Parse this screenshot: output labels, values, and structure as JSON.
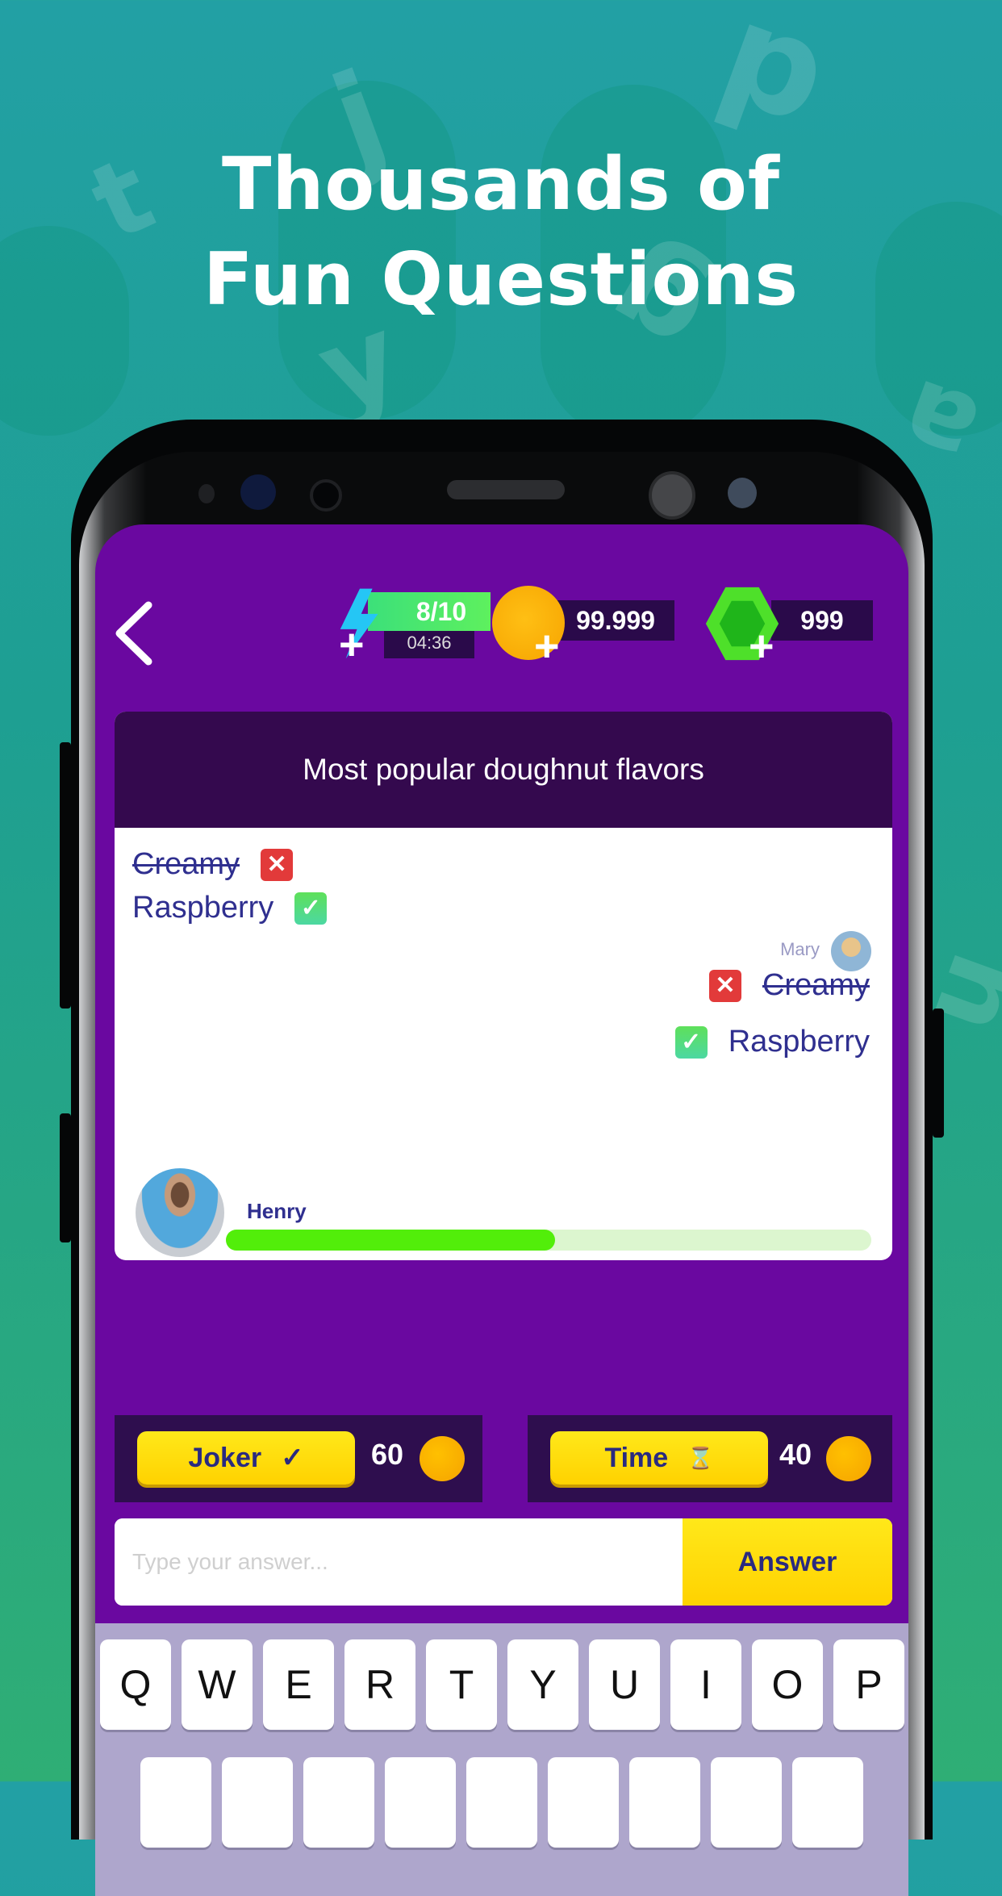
{
  "headline": {
    "line1": "Thousands of",
    "line2": "Fun Questions"
  },
  "background_letters": [
    "t",
    "j",
    "p",
    "y",
    "g",
    "a",
    "u"
  ],
  "colors": {
    "background_teal": "#22a0a4",
    "screen_purple": "#6a08a0",
    "question_header": "#34094e",
    "answer_text": "#2f2f8f",
    "wrong_badge": "#e23a3a",
    "correct_badge": "#5ee05a",
    "progress_fill": "#52ee0a",
    "button_yellow": "#ffd200",
    "coin_orange": "#f5a300"
  },
  "topbar": {
    "back_icon": "chevron-left-icon",
    "energy": {
      "icon": "lightning-icon",
      "value": "8/10",
      "timer": "04:36"
    },
    "coins": {
      "icon": "coin-icon",
      "value": "99.999"
    },
    "gems": {
      "icon": "gem-icon",
      "value": "999"
    }
  },
  "question": {
    "text": "Most popular doughnut flavors",
    "player_answers": [
      {
        "text": "Creamy",
        "status": "wrong"
      },
      {
        "text": "Raspberry",
        "status": "correct"
      }
    ],
    "opponent": {
      "name": "Mary",
      "answers": [
        {
          "text": "Creamy",
          "status": "wrong"
        },
        {
          "text": "Raspberry",
          "status": "correct"
        }
      ]
    },
    "player": {
      "name": "Henry",
      "progress_percent": 51
    }
  },
  "powerups": [
    {
      "label": "Joker",
      "icon": "check-icon",
      "icon_glyph": "✓",
      "cost": "60"
    },
    {
      "label": "Time",
      "icon": "hourglass-icon",
      "icon_glyph": "⌛",
      "cost": "40"
    }
  ],
  "answer_input": {
    "placeholder": "Type your answer...",
    "value": "",
    "button_label": "Answer"
  },
  "keyboard": {
    "row1": [
      "Q",
      "W",
      "E",
      "R",
      "T",
      "Y",
      "U",
      "I",
      "O",
      "P"
    ]
  }
}
